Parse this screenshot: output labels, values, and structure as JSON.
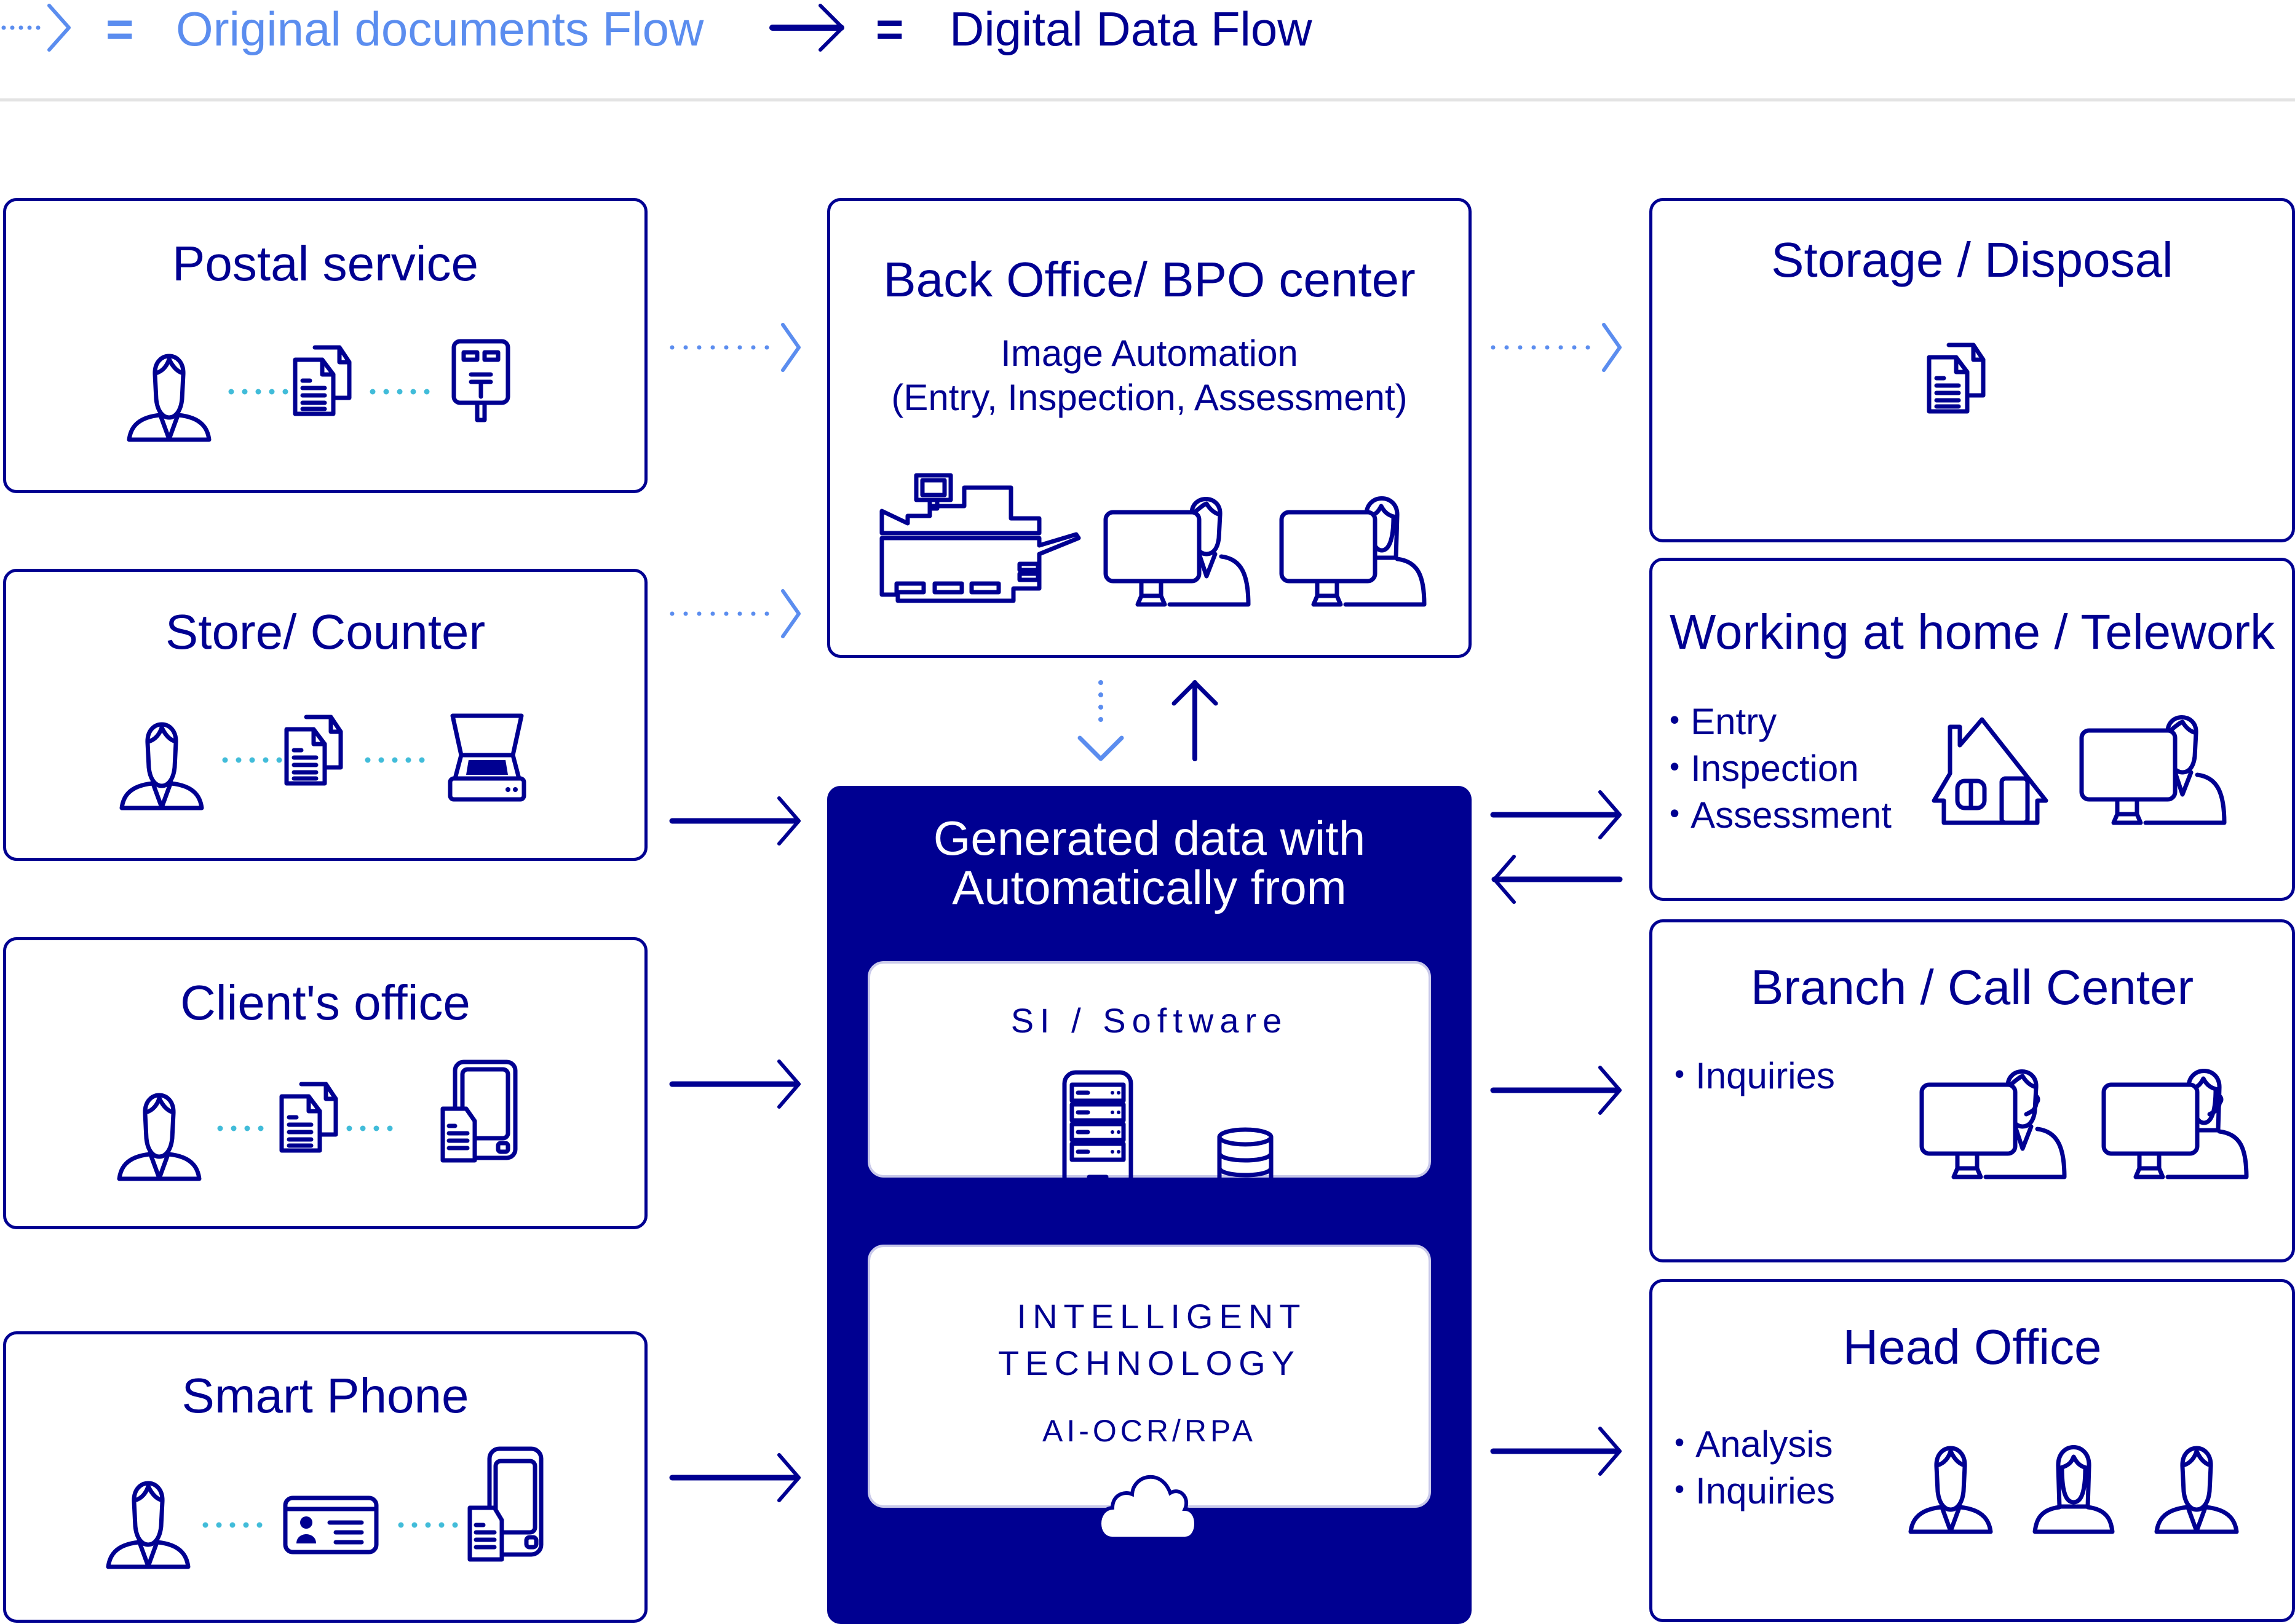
{
  "legend": {
    "original_flow": {
      "symbol": "=",
      "label": "Original documents Flow",
      "color": "#5b8def"
    },
    "digital_flow": {
      "symbol": "=",
      "label": "Digital Data Flow",
      "color": "#000091"
    }
  },
  "colors": {
    "primary": "#000091",
    "original_flow": "#5b8def",
    "connector_dots": "#41bcd9",
    "divider": "#e3e3e3"
  },
  "sources": [
    {
      "title": "Postal service",
      "icons": [
        "person-icon",
        "documents-icon",
        "postbox-icon"
      ],
      "flow": "original"
    },
    {
      "title": "Store/ Counter",
      "icons": [
        "person-icon",
        "documents-icon",
        "scanner-icon"
      ],
      "flow": "original+digital"
    },
    {
      "title": "Client's office",
      "icons": [
        "person-icon",
        "documents-icon",
        "tablet-icon"
      ],
      "flow": "digital"
    },
    {
      "title": "Smart Phone",
      "icons": [
        "person-icon",
        "id-card-icon",
        "smartphone-icon"
      ],
      "flow": "digital"
    }
  ],
  "bpo_center": {
    "title": "Back Office/ BPO center",
    "subtitle_line1": "Image Automation",
    "subtitle_line2": "(Entry, Inspection, Assessment)",
    "icons": [
      "scanner-machine-icon",
      "operator-male-icon",
      "operator-female-icon"
    ]
  },
  "generated": {
    "title_line1": "Generated data with",
    "title_line2": "Automatically from",
    "si_box": {
      "label": "SI / Software",
      "icons": [
        "server-icon",
        "database-icon"
      ]
    },
    "it_box": {
      "line1": "INTELLIGENT",
      "line2": "TECHNOLOGY",
      "line3": "AI-OCR/RPA",
      "icons": [
        "cloud-icon"
      ]
    }
  },
  "destinations": [
    {
      "title": "Storage / Disposal",
      "bullets": [],
      "icons": [
        "documents-icon"
      ],
      "flow": "original"
    },
    {
      "title": "Working at home / Telework",
      "bullets": [
        "Entry",
        "Inspection",
        "Assessment"
      ],
      "icons": [
        "house-icon",
        "operator-icon"
      ],
      "flow": "bidirectional"
    },
    {
      "title": "Branch / Call Center",
      "bullets": [
        "Inquiries"
      ],
      "icons": [
        "call-operator-male-icon",
        "call-operator-female-icon"
      ],
      "flow": "digital"
    },
    {
      "title": "Head Office",
      "bullets": [
        "Analysis",
        "Inquiries"
      ],
      "icons": [
        "person-male-icon",
        "person-female-icon",
        "person-male-icon"
      ],
      "flow": "digital"
    }
  ]
}
